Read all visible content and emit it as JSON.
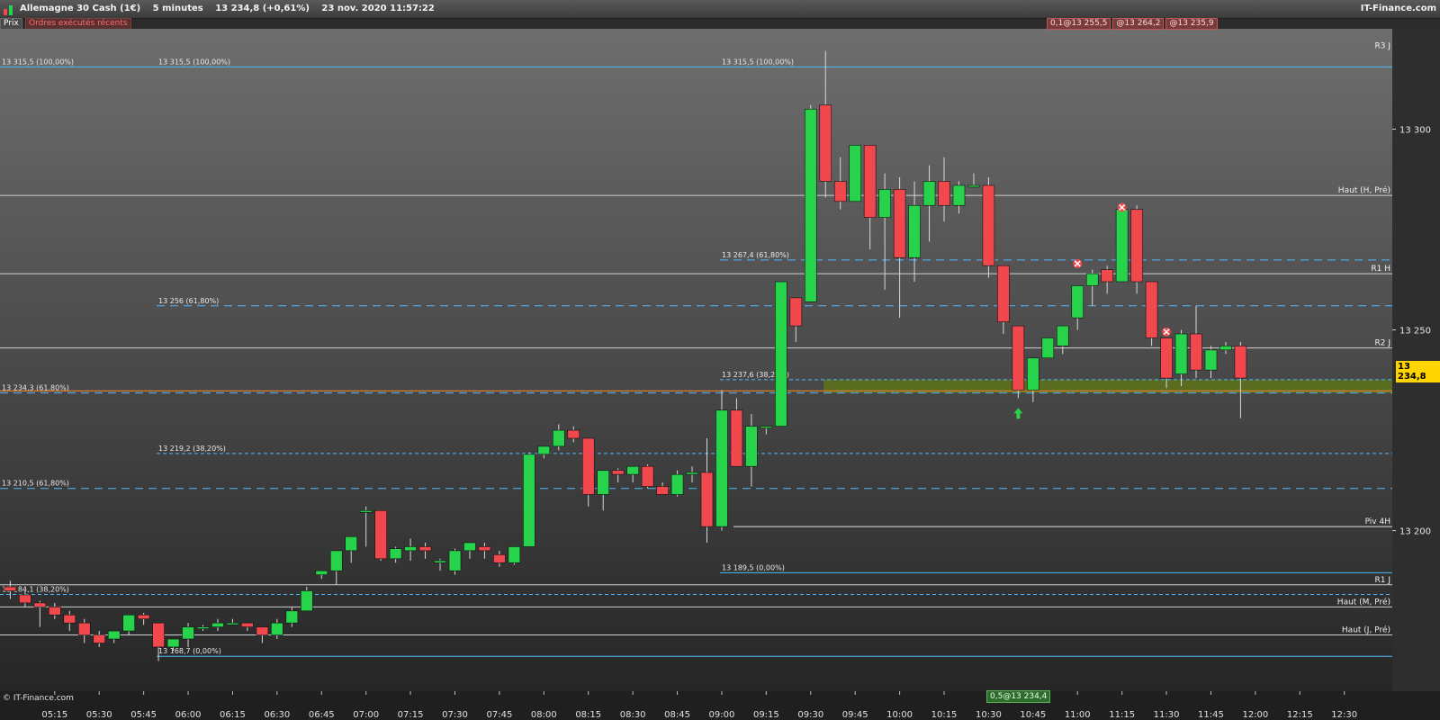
{
  "window": {
    "instrument": "Allemagne 30 Cash (1€)",
    "interval": "5 minutes",
    "quote": "13 234,8 (+0,61%)",
    "datetime": "23 nov. 2020 11:57:22",
    "brand": "IT-Finance.com"
  },
  "tabs": {
    "prix": "Prix",
    "orders": "Ordres exécutés récents"
  },
  "order_tags": [
    "0,1@13 255,5",
    "@13 264,2",
    "@13 235,9"
  ],
  "current_price": "13 234,8",
  "bottom_tag": "0,5@13 234,4",
  "copyright": "© IT-Finance.com",
  "colors": {
    "up": "#27d34a",
    "down": "#f0484c",
    "fib": "#4fb8ff",
    "price_line": "#d9822b",
    "zone": "#6a8a00"
  },
  "chart_data": {
    "type": "candlestick",
    "ylim": [
      13160,
      13325
    ],
    "y_ticks": [
      {
        "value": 13300,
        "label": "13 300"
      },
      {
        "value": 13250,
        "label": "13 250"
      },
      {
        "value": 13200,
        "label": "13 200"
      }
    ],
    "x_ticks": [
      "05:15",
      "05:30",
      "05:45",
      "06:00",
      "06:15",
      "06:30",
      "06:45",
      "07:00",
      "07:15",
      "07:30",
      "07:45",
      "08:00",
      "08:15",
      "08:30",
      "08:45",
      "09:00",
      "09:15",
      "09:30",
      "09:45",
      "10:00",
      "10:15",
      "10:30",
      "10:45",
      "11:00",
      "11:15",
      "11:30",
      "11:45",
      "12:00",
      "12:15",
      "12:30"
    ],
    "x_tick_start": "05:15",
    "candle_start": "05:00",
    "candle_minutes": 5,
    "candles": [
      [
        13186.0,
        13187.5,
        13183.0,
        13185.0
      ],
      [
        13184.0,
        13185.0,
        13181.0,
        13182.0
      ],
      [
        13182.0,
        13182.5,
        13176.0,
        13181.0
      ],
      [
        13181.0,
        13182.0,
        13178.0,
        13179.0
      ],
      [
        13179.0,
        13180.0,
        13175.0,
        13177.0
      ],
      [
        13177.0,
        13178.0,
        13172.0,
        13174.0
      ],
      [
        13174.0,
        13175.0,
        13171.0,
        13172.0
      ],
      [
        13173.0,
        13175.0,
        13172.0,
        13175.0
      ],
      [
        13175.0,
        13179.0,
        13174.0,
        13179.0
      ],
      [
        13179.0,
        13179.5,
        13176.5,
        13178.0
      ],
      [
        13177.0,
        13177.0,
        13167.5,
        13171.0
      ],
      [
        13171.0,
        13173.0,
        13170.0,
        13173.0
      ],
      [
        13173.0,
        13177.0,
        13171.0,
        13176.0
      ],
      [
        13176.0,
        13176.5,
        13175.0,
        13176.0
      ],
      [
        13176.0,
        13178.0,
        13175.0,
        13177.0
      ],
      [
        13177.0,
        13178.0,
        13176.5,
        13177.0
      ],
      [
        13177.0,
        13177.0,
        13175.0,
        13176.0
      ],
      [
        13176.0,
        13176.0,
        13172.0,
        13174.0
      ],
      [
        13174.0,
        13178.0,
        13173.0,
        13177.0
      ],
      [
        13177.0,
        13181.0,
        13176.0,
        13180.0
      ],
      [
        13180.0,
        13186.0,
        13180.0,
        13185.0
      ],
      [
        13189.0,
        13190.0,
        13188.0,
        13190.0
      ],
      [
        13190.0,
        13195.0,
        13186.5,
        13195.0
      ],
      [
        13195.0,
        13198.5,
        13192.0,
        13198.5
      ],
      [
        13205.0,
        13206.0,
        13196.0,
        13205.0
      ],
      [
        13205.0,
        13205.0,
        13192.5,
        13193.0
      ],
      [
        13193.0,
        13196.0,
        13192.0,
        13195.5
      ],
      [
        13195.0,
        13198.0,
        13192.5,
        13196.0
      ],
      [
        13196.0,
        13197.0,
        13193.0,
        13195.0
      ],
      [
        13192.0,
        13193.0,
        13190.0,
        13192.5
      ],
      [
        13190.0,
        13195.5,
        13189.0,
        13195.0
      ],
      [
        13195.0,
        13197.0,
        13193.0,
        13197.0
      ],
      [
        13196.0,
        13197.0,
        13193.0,
        13195.0
      ],
      [
        13194.0,
        13195.0,
        13191.0,
        13192.0
      ],
      [
        13192.0,
        13196.0,
        13191.5,
        13196.0
      ],
      [
        13196.0,
        13219.5,
        13196.0,
        13219.0
      ],
      [
        13219.0,
        13221.0,
        13218.0,
        13221.0
      ],
      [
        13221.0,
        13226.5,
        13220.0,
        13225.0
      ],
      [
        13225.0,
        13226.0,
        13222.0,
        13223.0
      ],
      [
        13223.0,
        13223.0,
        13206.0,
        13209.0
      ],
      [
        13209.0,
        13214.0,
        13205.0,
        13215.0
      ],
      [
        13215.0,
        13215.5,
        13212.0,
        13214.0
      ],
      [
        13214.0,
        13216.0,
        13212.0,
        13216.0
      ],
      [
        13216.0,
        13216.5,
        13210.5,
        13211.0
      ],
      [
        13211.0,
        13212.0,
        13209.0,
        13209.0
      ],
      [
        13209.0,
        13215.0,
        13208.5,
        13214.0
      ],
      [
        13214.0,
        13216.0,
        13212.0,
        13214.5
      ],
      [
        13214.5,
        13223.0,
        13197.0,
        13201.0
      ],
      [
        13201.0,
        13235.0,
        13200.0,
        13230.0
      ],
      [
        13230.0,
        13233.0,
        13216.0,
        13216.0
      ],
      [
        13216.0,
        13229.0,
        13211.0,
        13226.0
      ],
      [
        13226.0,
        13226.0,
        13224.0,
        13226.0
      ],
      [
        13226.0,
        13262.0,
        13226.0,
        13262.0
      ],
      [
        13258.0,
        13258.0,
        13247.0,
        13251.0
      ],
      [
        13257.0,
        13306.0,
        13257.0,
        13305.0
      ],
      [
        13306.0,
        13319.5,
        13283.0,
        13287.0
      ],
      [
        13287.0,
        13293.0,
        13280.0,
        13282.0
      ],
      [
        13282.0,
        13296.0,
        13282.0,
        13296.0
      ],
      [
        13296.0,
        13296.0,
        13270.0,
        13278.0
      ],
      [
        13278.0,
        13289.0,
        13260.0,
        13285.0
      ],
      [
        13285.0,
        13288.0,
        13253.0,
        13268.0
      ],
      [
        13268.0,
        13287.0,
        13262.0,
        13281.0
      ],
      [
        13281.0,
        13291.0,
        13272.0,
        13287.0
      ],
      [
        13287.0,
        13293.0,
        13277.0,
        13281.0
      ],
      [
        13281.0,
        13287.0,
        13279.0,
        13286.0
      ],
      [
        13286.0,
        13289.0,
        13286.0,
        13286.0
      ],
      [
        13286.0,
        13288.0,
        13263.0,
        13266.0
      ],
      [
        13266.0,
        13265.0,
        13249.0,
        13252.0
      ],
      [
        13251.0,
        13251.0,
        13233.0,
        13235.0
      ],
      [
        13235.0,
        13243.0,
        13232.0,
        13243.0
      ],
      [
        13243.0,
        13246.0,
        13243.0,
        13248.0
      ],
      [
        13246.0,
        13250.0,
        13244.0,
        13251.0
      ],
      [
        13253.0,
        13261.0,
        13250.0,
        13261.0
      ],
      [
        13261.0,
        13265.0,
        13256.0,
        13264.0
      ],
      [
        13265.0,
        13266.0,
        13259.0,
        13262.0
      ],
      [
        13262.0,
        13280.0,
        13262.0,
        13280.0
      ],
      [
        13280.0,
        13281.0,
        13259.0,
        13262.0
      ],
      [
        13262.0,
        13262.0,
        13246.0,
        13248.0
      ],
      [
        13248.0,
        13248.0,
        13235.5,
        13238.0
      ],
      [
        13239.0,
        13250.0,
        13236.0,
        13249.0
      ],
      [
        13249.0,
        13256.0,
        13238.0,
        13240.0
      ],
      [
        13240.0,
        13246.0,
        13238.0,
        13245.0
      ],
      [
        13245.0,
        13247.0,
        13244.0,
        13246.0
      ],
      [
        13246.0,
        13247.0,
        13228.0,
        13238.0
      ]
    ],
    "levels": [
      {
        "value": 13315.5,
        "label": "13 315,5 (100,00%)",
        "style": "solid",
        "color": "#4fb8ff",
        "from_label": "13 315,5 (100,00%)"
      },
      {
        "value": 13283.5,
        "label": "Haut (H, Pré)",
        "style": "solid",
        "color": "#d0d0d0"
      },
      {
        "value": 13267.4,
        "label": "13 267,4 (61,80%)",
        "style": "dash",
        "color": "#4fb8ff"
      },
      {
        "value": 13264.0,
        "label": "R1 H",
        "style": "solid",
        "color": "#d0d0d0"
      },
      {
        "value": 13256.0,
        "label": "13 256 (61,80%)",
        "style": "dash",
        "color": "#4fb8ff"
      },
      {
        "value": 13245.5,
        "label": "R2 J",
        "style": "solid",
        "color": "#d0d0d0"
      },
      {
        "value": 13237.6,
        "label": "13 237,6 (38,20%)",
        "style": "dashsmall",
        "color": "#4fb8ff"
      },
      {
        "value": 13234.3,
        "label": "13 234,3 (61,80%)",
        "style": "dash",
        "color": "#4fb8ff"
      },
      {
        "value": 13219.2,
        "label": "13 219,2 (38,20%)",
        "style": "dashsmall",
        "color": "#4fb8ff"
      },
      {
        "value": 13210.5,
        "label": "13 210,5 (61,80%)",
        "style": "dash",
        "color": "#4fb8ff"
      },
      {
        "value": 13201.0,
        "label": "Piv 4H",
        "style": "solid",
        "color": "#e0e0e0"
      },
      {
        "value": 13189.5,
        "label": "13 189,5 (0,00%)",
        "style": "solid",
        "color": "#4fb8ff"
      },
      {
        "value": 13186.5,
        "label": "R1 J",
        "style": "solid",
        "color": "#d0d0d0"
      },
      {
        "value": 13184.1,
        "label": "13 184,1 (38,20%)",
        "style": "dashsmall",
        "color": "#4fb8ff"
      },
      {
        "value": 13181.0,
        "label": "Haut (M, Pré)",
        "style": "solid",
        "color": "#d0d0d0"
      },
      {
        "value": 13174.0,
        "label": "Haut (J, Pré)",
        "style": "solid",
        "color": "#d0d0d0"
      },
      {
        "value": 13168.7,
        "label": "13 168,7 (0,00%)",
        "style": "solid",
        "color": "#4fb8ff"
      },
      {
        "value": 13234.8,
        "label": "",
        "style": "price",
        "color": "#d9822b"
      }
    ],
    "right_labels": [
      "R3 J",
      "Haut (H, Pré)",
      "R1 H",
      "R2 J",
      "Piv 4H",
      "R1 J",
      "Haut (M, Pré)",
      "Haut (J, Pré)"
    ],
    "markers": [
      {
        "type": "sell",
        "time": "11:15",
        "value": 13280.5
      },
      {
        "type": "sell",
        "time": "11:00",
        "value": 13266.5
      },
      {
        "type": "sell",
        "time": "11:30",
        "value": 13249.5
      },
      {
        "type": "buy",
        "time": "10:40",
        "value": 13229.0
      }
    ]
  }
}
